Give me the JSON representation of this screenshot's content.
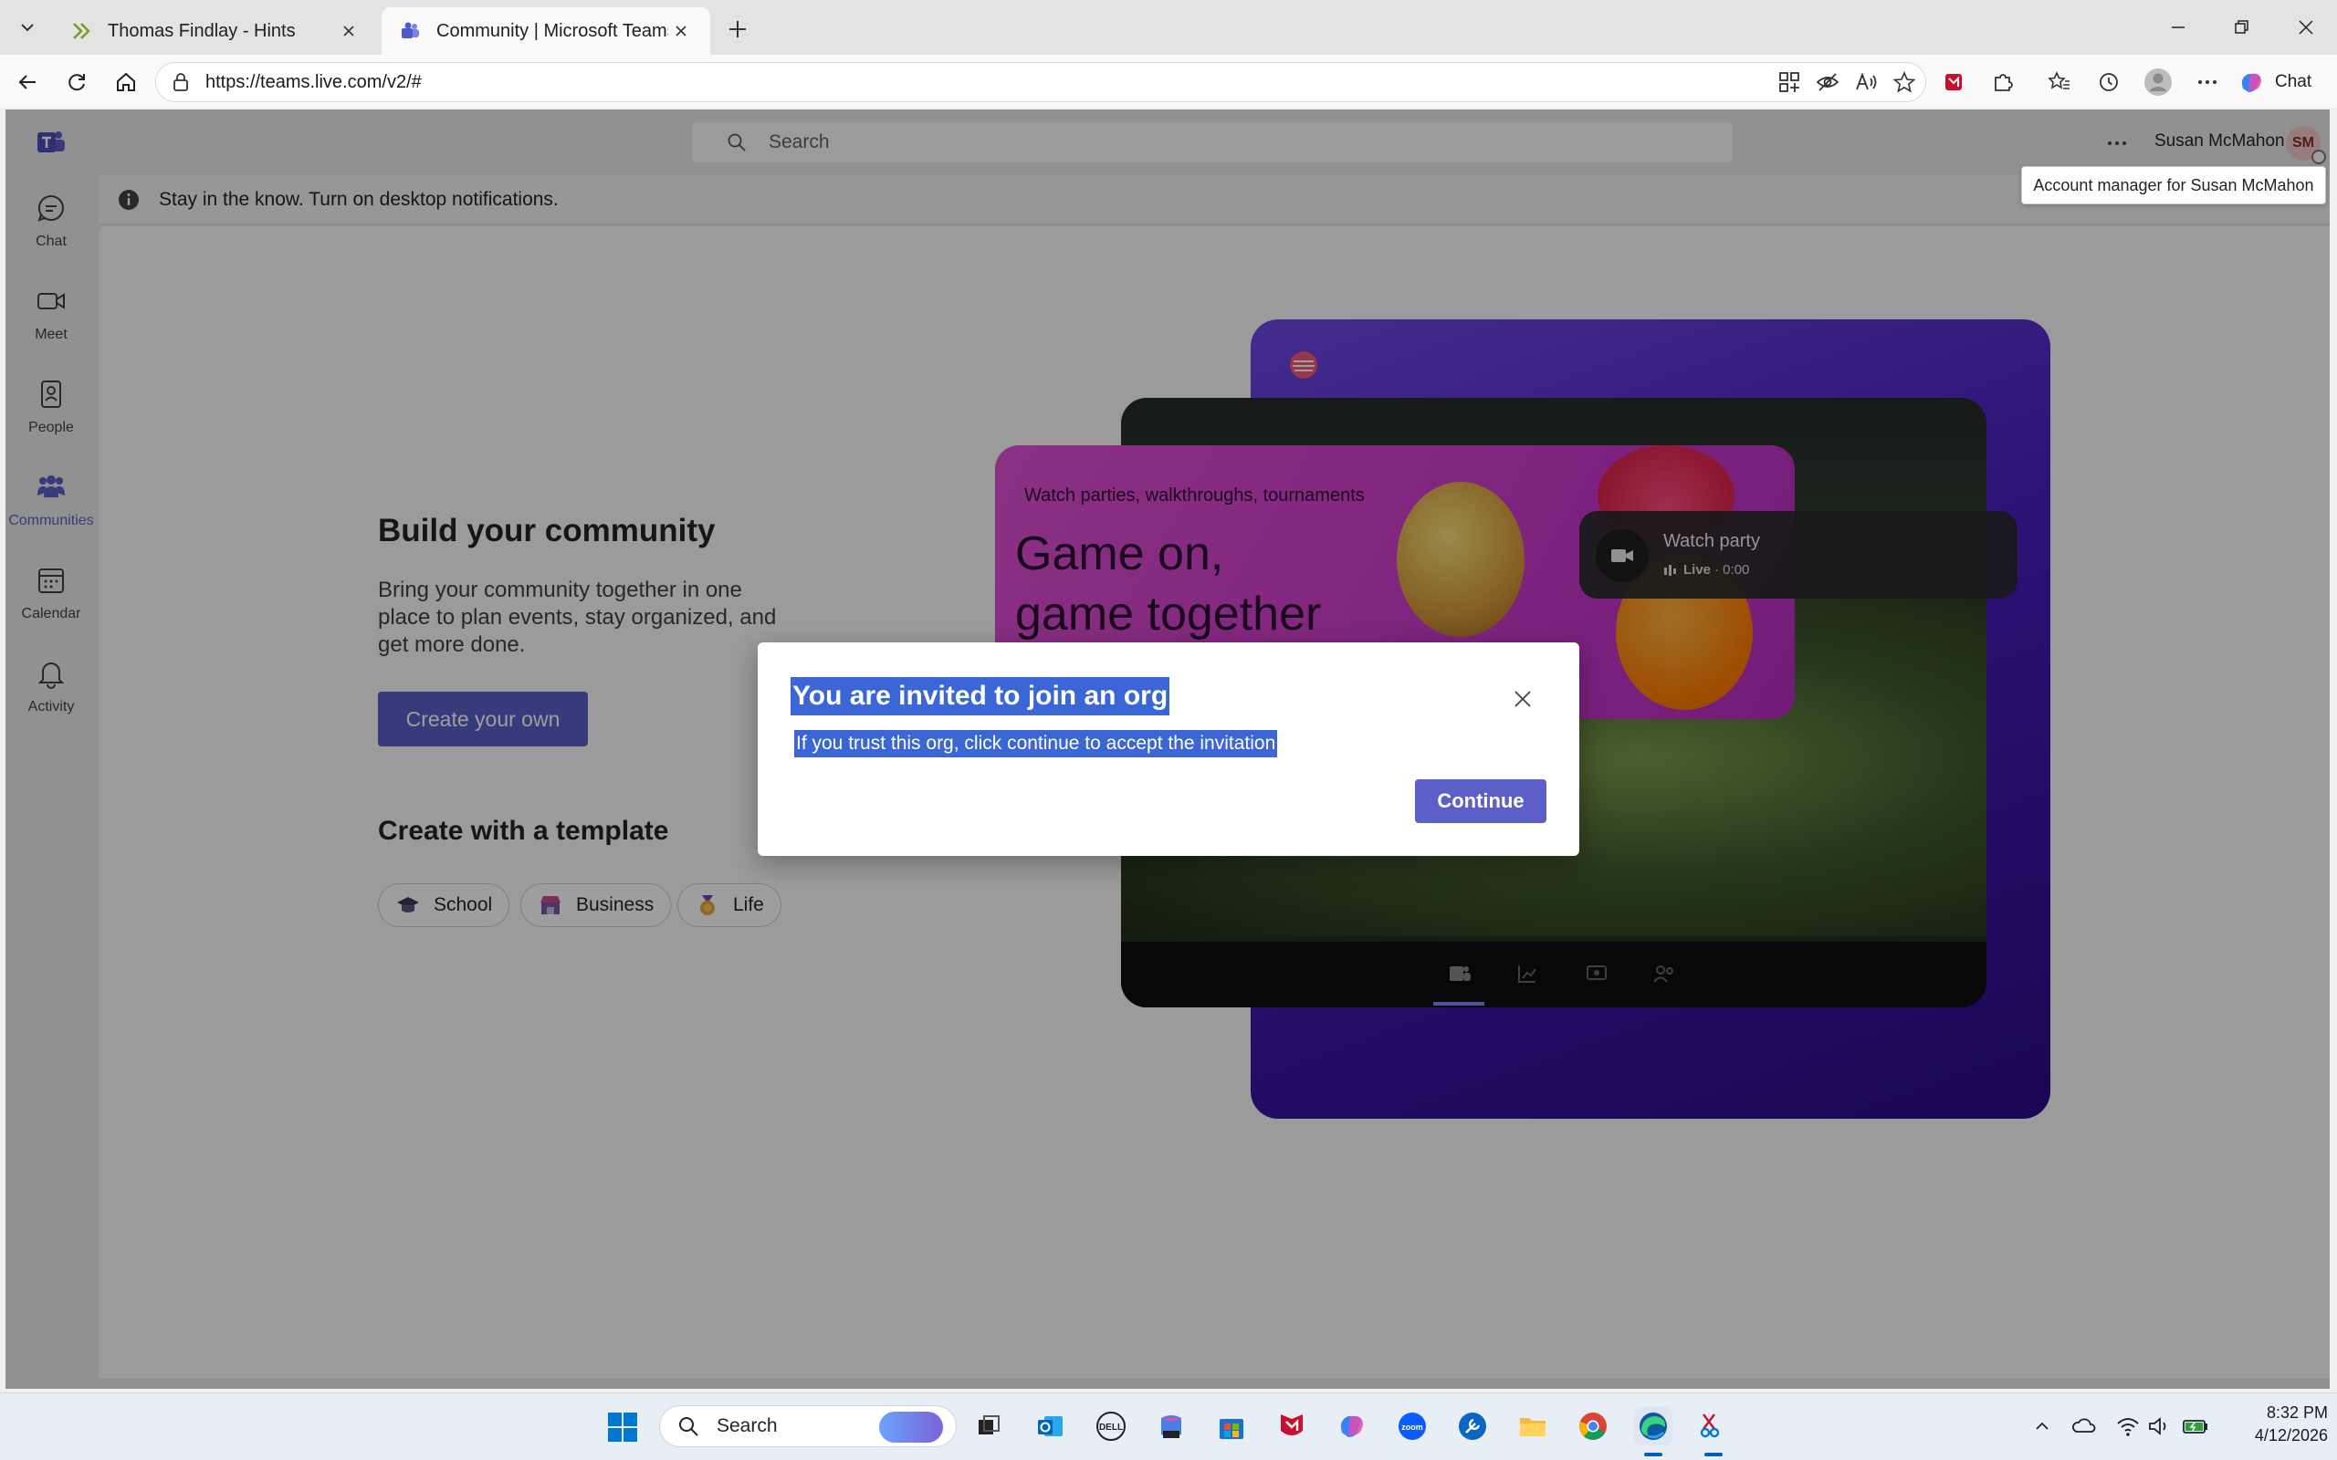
{
  "browser": {
    "tabs": [
      {
        "title": "Thomas Findlay - Hints",
        "active": false
      },
      {
        "title": "Community | Microsoft Teams",
        "active": true
      }
    ],
    "url": "https://teams.live.com/v2/#",
    "copilot_label": "Chat"
  },
  "teams": {
    "search_placeholder": "Search",
    "user_name": "Susan McMahon",
    "user_initials": "SM",
    "tooltip": "Account manager for Susan McMahon",
    "notification": "Stay in the know. Turn on desktop notifications.",
    "rail": [
      {
        "label": "Chat",
        "icon": "chat-icon"
      },
      {
        "label": "Meet",
        "icon": "video-camera-icon"
      },
      {
        "label": "People",
        "icon": "contact-card-icon"
      },
      {
        "label": "Communities",
        "icon": "communities-icon",
        "active": true
      },
      {
        "label": "Calendar",
        "icon": "calendar-icon"
      },
      {
        "label": "Activity",
        "icon": "bell-icon"
      }
    ],
    "main": {
      "heading": "Build your community",
      "description": "Bring your community together in one place to plan events, stay organized, and get more done.",
      "create_button": "Create your own",
      "template_heading": "Create with a template",
      "templates": [
        {
          "label": "School",
          "icon": "graduation-cap-icon"
        },
        {
          "label": "Business",
          "icon": "store-icon"
        },
        {
          "label": "Life",
          "icon": "medal-icon"
        }
      ]
    },
    "hero": {
      "eyebrow": "Watch parties, walkthroughs, tournaments",
      "headline_line1": "Game on,",
      "headline_line2": "game together",
      "card_title": "Watch party",
      "card_live": "Live",
      "card_time": "· 0:00"
    },
    "dialog": {
      "title": "You are invited to join an org",
      "body": "If you trust this org, click continue to accept the invitation",
      "continue": "Continue"
    }
  },
  "taskbar": {
    "search_label": "Search",
    "time": "8:32 PM",
    "date": "4/12/2026"
  },
  "colors": {
    "teams_accent": "#5b5fc7",
    "selection": "#3b66d6"
  }
}
